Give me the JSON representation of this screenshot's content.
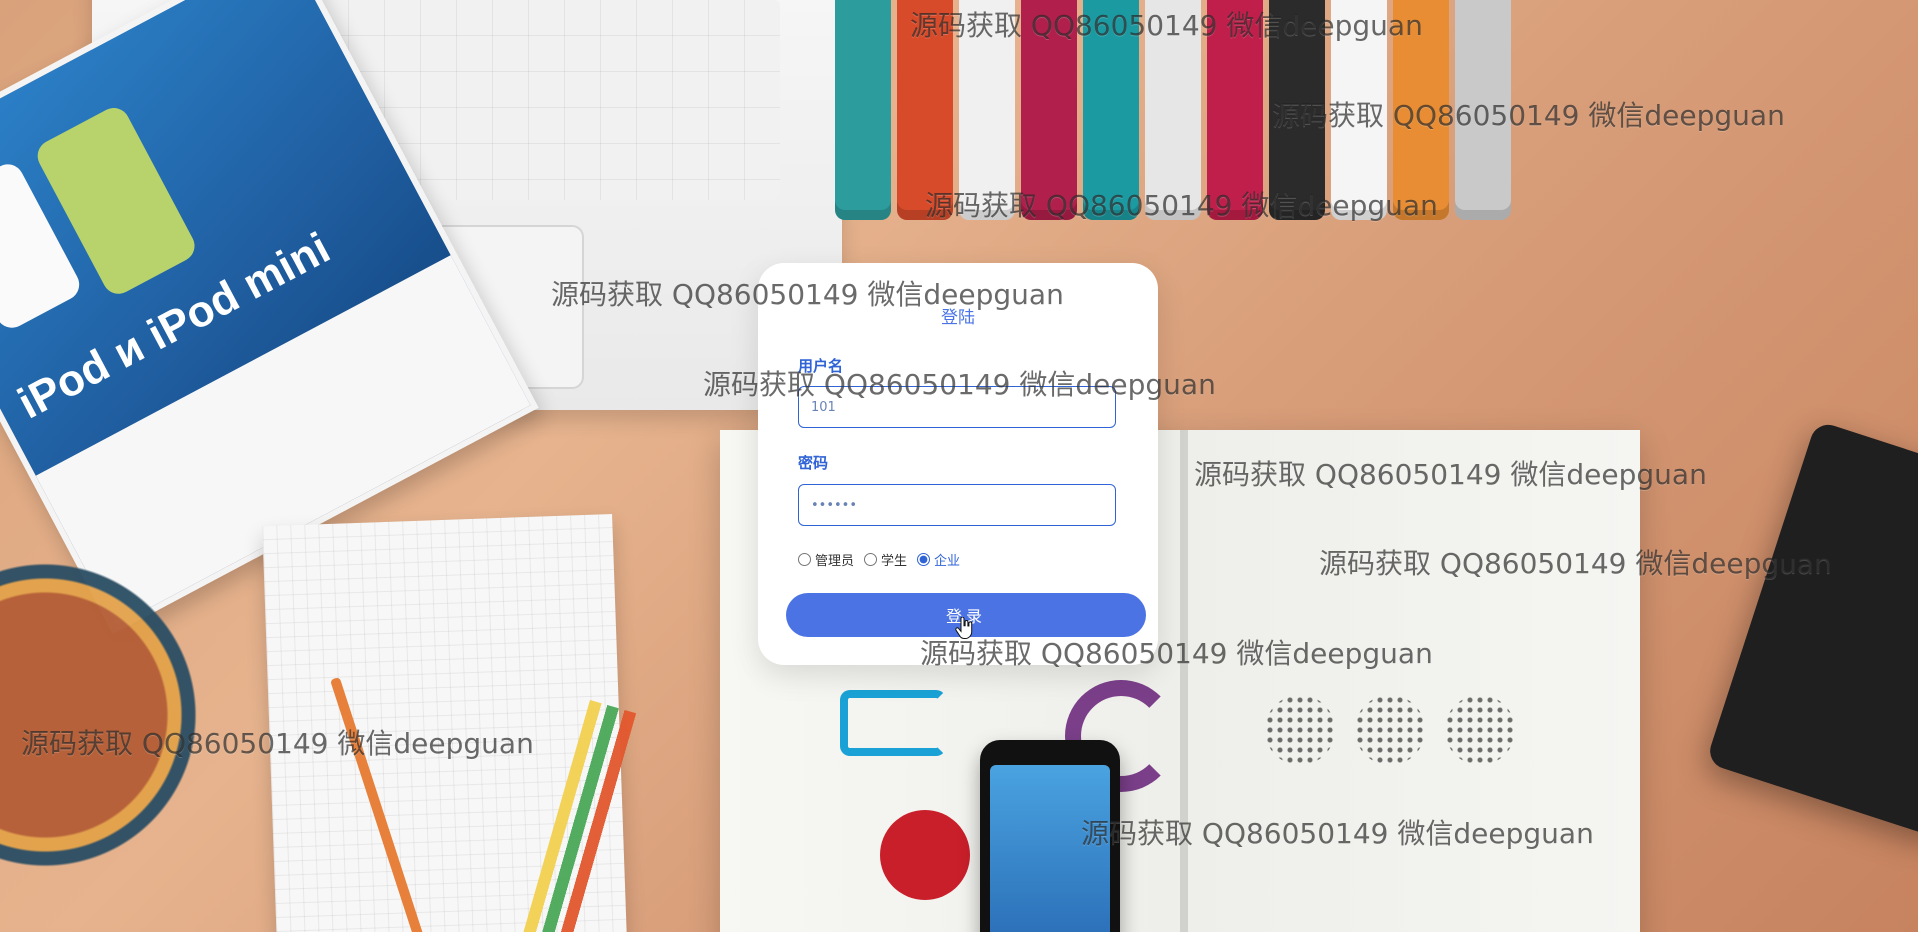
{
  "background": {
    "watermark_text": "源码获取 QQ86050149 微信deepguan",
    "colors": {
      "desk": "#d9a27b",
      "accent_blue": "#4b73e4",
      "label_blue": "#2f63d6"
    }
  },
  "login": {
    "title": "登陆",
    "username_label": "用户名",
    "username_value": "101",
    "password_label": "密码",
    "password_value": "123456",
    "roles": [
      {
        "label": "管理员",
        "value": "admin",
        "selected": false
      },
      {
        "label": "学生",
        "value": "student",
        "selected": false
      },
      {
        "label": "企业",
        "value": "company",
        "selected": true
      }
    ],
    "submit_label": "登录"
  },
  "icons": {
    "cursor": "hand-pointer-icon"
  }
}
